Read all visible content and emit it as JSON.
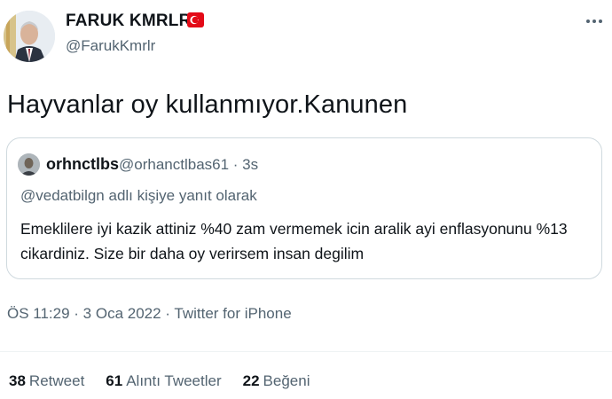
{
  "author": {
    "display_name": "FARUK KMRLR",
    "handle": "@FarukKmrlr",
    "badge_icon": "turkey-flag-icon"
  },
  "tweet": {
    "text": "Hayvanlar oy kullanmıyor.Kanunen"
  },
  "quote": {
    "name": "orhnctlbs",
    "handle_time": "@orhanctlbas61 · 3s",
    "reply_to": "@vedatbilgn adlı kişiye yanıt olarak",
    "text": "Emeklilere iyi kazik attiniz %40 zam vermemek icin aralik ayi enflasyonunu %13 cikardiniz. Size bir daha oy verirsem insan degilim"
  },
  "meta": {
    "timestamp": "ÖS 11:29 · 3 Oca 2022 · Twitter for iPhone"
  },
  "stats": [
    {
      "count": "38",
      "label": "Retweet"
    },
    {
      "count": "61",
      "label": "Alıntı Tweetler"
    },
    {
      "count": "22",
      "label": "Beğeni"
    }
  ],
  "colors": {
    "text": "#0f1419",
    "secondary": "#536471",
    "border": "#cfd9de",
    "flag_red": "#e30a17"
  }
}
